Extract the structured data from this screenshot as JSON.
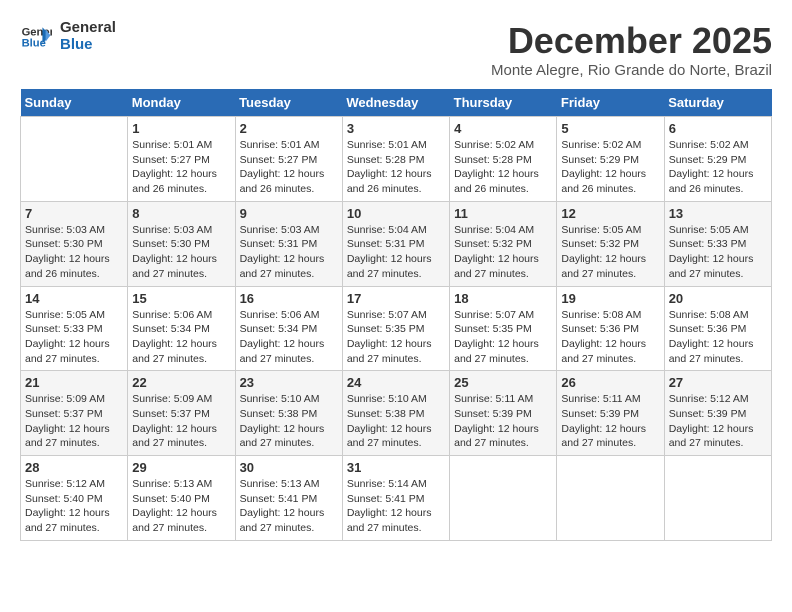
{
  "logo": {
    "line1": "General",
    "line2": "Blue"
  },
  "title": "December 2025",
  "location": "Monte Alegre, Rio Grande do Norte, Brazil",
  "weekdays": [
    "Sunday",
    "Monday",
    "Tuesday",
    "Wednesday",
    "Thursday",
    "Friday",
    "Saturday"
  ],
  "weeks": [
    [
      {
        "day": "",
        "info": ""
      },
      {
        "day": "1",
        "info": "Sunrise: 5:01 AM\nSunset: 5:27 PM\nDaylight: 12 hours\nand 26 minutes."
      },
      {
        "day": "2",
        "info": "Sunrise: 5:01 AM\nSunset: 5:27 PM\nDaylight: 12 hours\nand 26 minutes."
      },
      {
        "day": "3",
        "info": "Sunrise: 5:01 AM\nSunset: 5:28 PM\nDaylight: 12 hours\nand 26 minutes."
      },
      {
        "day": "4",
        "info": "Sunrise: 5:02 AM\nSunset: 5:28 PM\nDaylight: 12 hours\nand 26 minutes."
      },
      {
        "day": "5",
        "info": "Sunrise: 5:02 AM\nSunset: 5:29 PM\nDaylight: 12 hours\nand 26 minutes."
      },
      {
        "day": "6",
        "info": "Sunrise: 5:02 AM\nSunset: 5:29 PM\nDaylight: 12 hours\nand 26 minutes."
      }
    ],
    [
      {
        "day": "7",
        "info": "Sunrise: 5:03 AM\nSunset: 5:30 PM\nDaylight: 12 hours\nand 26 minutes."
      },
      {
        "day": "8",
        "info": "Sunrise: 5:03 AM\nSunset: 5:30 PM\nDaylight: 12 hours\nand 27 minutes."
      },
      {
        "day": "9",
        "info": "Sunrise: 5:03 AM\nSunset: 5:31 PM\nDaylight: 12 hours\nand 27 minutes."
      },
      {
        "day": "10",
        "info": "Sunrise: 5:04 AM\nSunset: 5:31 PM\nDaylight: 12 hours\nand 27 minutes."
      },
      {
        "day": "11",
        "info": "Sunrise: 5:04 AM\nSunset: 5:32 PM\nDaylight: 12 hours\nand 27 minutes."
      },
      {
        "day": "12",
        "info": "Sunrise: 5:05 AM\nSunset: 5:32 PM\nDaylight: 12 hours\nand 27 minutes."
      },
      {
        "day": "13",
        "info": "Sunrise: 5:05 AM\nSunset: 5:33 PM\nDaylight: 12 hours\nand 27 minutes."
      }
    ],
    [
      {
        "day": "14",
        "info": "Sunrise: 5:05 AM\nSunset: 5:33 PM\nDaylight: 12 hours\nand 27 minutes."
      },
      {
        "day": "15",
        "info": "Sunrise: 5:06 AM\nSunset: 5:34 PM\nDaylight: 12 hours\nand 27 minutes."
      },
      {
        "day": "16",
        "info": "Sunrise: 5:06 AM\nSunset: 5:34 PM\nDaylight: 12 hours\nand 27 minutes."
      },
      {
        "day": "17",
        "info": "Sunrise: 5:07 AM\nSunset: 5:35 PM\nDaylight: 12 hours\nand 27 minutes."
      },
      {
        "day": "18",
        "info": "Sunrise: 5:07 AM\nSunset: 5:35 PM\nDaylight: 12 hours\nand 27 minutes."
      },
      {
        "day": "19",
        "info": "Sunrise: 5:08 AM\nSunset: 5:36 PM\nDaylight: 12 hours\nand 27 minutes."
      },
      {
        "day": "20",
        "info": "Sunrise: 5:08 AM\nSunset: 5:36 PM\nDaylight: 12 hours\nand 27 minutes."
      }
    ],
    [
      {
        "day": "21",
        "info": "Sunrise: 5:09 AM\nSunset: 5:37 PM\nDaylight: 12 hours\nand 27 minutes."
      },
      {
        "day": "22",
        "info": "Sunrise: 5:09 AM\nSunset: 5:37 PM\nDaylight: 12 hours\nand 27 minutes."
      },
      {
        "day": "23",
        "info": "Sunrise: 5:10 AM\nSunset: 5:38 PM\nDaylight: 12 hours\nand 27 minutes."
      },
      {
        "day": "24",
        "info": "Sunrise: 5:10 AM\nSunset: 5:38 PM\nDaylight: 12 hours\nand 27 minutes."
      },
      {
        "day": "25",
        "info": "Sunrise: 5:11 AM\nSunset: 5:39 PM\nDaylight: 12 hours\nand 27 minutes."
      },
      {
        "day": "26",
        "info": "Sunrise: 5:11 AM\nSunset: 5:39 PM\nDaylight: 12 hours\nand 27 minutes."
      },
      {
        "day": "27",
        "info": "Sunrise: 5:12 AM\nSunset: 5:39 PM\nDaylight: 12 hours\nand 27 minutes."
      }
    ],
    [
      {
        "day": "28",
        "info": "Sunrise: 5:12 AM\nSunset: 5:40 PM\nDaylight: 12 hours\nand 27 minutes."
      },
      {
        "day": "29",
        "info": "Sunrise: 5:13 AM\nSunset: 5:40 PM\nDaylight: 12 hours\nand 27 minutes."
      },
      {
        "day": "30",
        "info": "Sunrise: 5:13 AM\nSunset: 5:41 PM\nDaylight: 12 hours\nand 27 minutes."
      },
      {
        "day": "31",
        "info": "Sunrise: 5:14 AM\nSunset: 5:41 PM\nDaylight: 12 hours\nand 27 minutes."
      },
      {
        "day": "",
        "info": ""
      },
      {
        "day": "",
        "info": ""
      },
      {
        "day": "",
        "info": ""
      }
    ]
  ]
}
